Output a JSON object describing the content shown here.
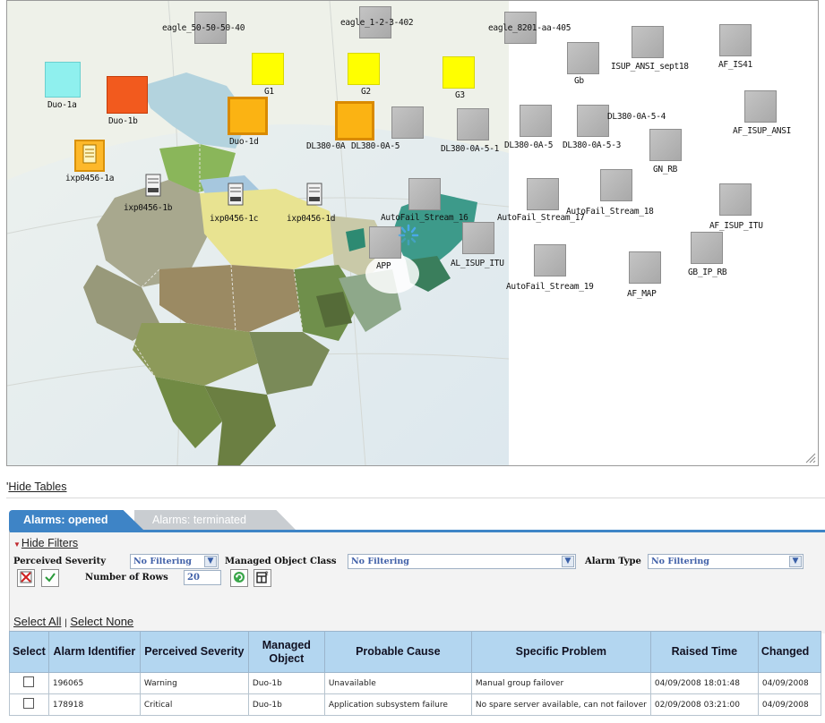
{
  "map": {
    "nodes": [
      {
        "id": "eagle_50-50-50-40",
        "label": "eagle_50-50-50-40",
        "color": "gray"
      },
      {
        "id": "eagle_1-2-3-402",
        "label": "eagle_1-2-3-402",
        "color": "gray"
      },
      {
        "id": "eagle_8201-aa-405",
        "label": "eagle_8201-aa-405",
        "color": "gray"
      },
      {
        "id": "Gb",
        "label": "Gb",
        "color": "gray"
      },
      {
        "id": "ISUP_ANSI_sept18",
        "label": "ISUP_ANSI_sept18",
        "color": "gray"
      },
      {
        "id": "AF_IS41",
        "label": "AF_IS41",
        "color": "gray"
      },
      {
        "id": "G1",
        "label": "G1",
        "color": "yellow"
      },
      {
        "id": "G2",
        "label": "G2",
        "color": "yellow"
      },
      {
        "id": "G3",
        "label": "G3",
        "color": "yellow"
      },
      {
        "id": "Duo-1a",
        "label": "Duo-1a",
        "color": "cyan"
      },
      {
        "id": "Duo-1b",
        "label": "Duo-1b",
        "color": "red"
      },
      {
        "id": "Duo-1d",
        "label": "Duo-1d",
        "color": "orange"
      },
      {
        "id": "DL380-0A",
        "label": "DL380-0A",
        "color": "orange"
      },
      {
        "id": "DL380-0A-5",
        "label": "DL380-0A-5",
        "color": "gray"
      },
      {
        "id": "DL380-0A-5-1",
        "label": "DL380-0A-5-1",
        "color": "gray"
      },
      {
        "id": "DL380-0A-5",
        "label": "DL380-0A-5",
        "color": "gray"
      },
      {
        "id": "DL380-0A-5-3",
        "label": "DL380-0A-5-3",
        "color": "gray"
      },
      {
        "id": "DL380-0A-5-4",
        "label": "DL380-0A-5-4",
        "color": "gray"
      },
      {
        "id": "AF_ISUP_ANSI",
        "label": "AF_ISUP_ANSI",
        "color": "gray"
      },
      {
        "id": "GN_RB",
        "label": "GN_RB",
        "color": "gray"
      },
      {
        "id": "ixp0456-1a",
        "label": "ixp0456-1a",
        "color": "orange"
      },
      {
        "id": "ixp0456-1b",
        "label": "ixp0456-1b",
        "color": "server"
      },
      {
        "id": "ixp0456-1c",
        "label": "ixp0456-1c",
        "color": "server"
      },
      {
        "id": "ixp0456-1d",
        "label": "ixp0456-1d",
        "color": "server"
      },
      {
        "id": "AutoFail_Stream_16",
        "label": "AutoFail_Stream_16",
        "color": "gray"
      },
      {
        "id": "AutoFail_Stream_17",
        "label": "AutoFail_Stream_17",
        "color": "gray"
      },
      {
        "id": "AutoFail_Stream_18",
        "label": "AutoFail_Stream_18",
        "color": "gray"
      },
      {
        "id": "AF_ISUP_ITU",
        "label": "AF_ISUP_ITU",
        "color": "gray"
      },
      {
        "id": "APP",
        "label": "APP",
        "color": "gray"
      },
      {
        "id": "AL_ISUP_ITU",
        "label": "AL_ISUP_ITU",
        "color": "gray"
      },
      {
        "id": "AutoFail_Stream_19",
        "label": "AutoFail_Stream_19",
        "color": "gray"
      },
      {
        "id": "AF_MAP",
        "label": "AF_MAP",
        "color": "gray"
      },
      {
        "id": "GB_IP_RB",
        "label": "GB_IP_RB",
        "color": "gray"
      }
    ]
  },
  "links": {
    "hide_tables": "Hide Tables",
    "hide_filters": "Hide Filters",
    "select_all": "Select All",
    "separator": "|",
    "select_none": "Select None"
  },
  "tabs": [
    {
      "label": "Alarms: opened",
      "active": true
    },
    {
      "label": "Alarms: terminated",
      "active": false
    }
  ],
  "filters": {
    "perceived_severity": {
      "label": "Perceived Severity",
      "value": "No Filtering"
    },
    "managed_object_class": {
      "label": "Managed Object Class",
      "value": "No Filtering"
    },
    "alarm_type": {
      "label": "Alarm Type",
      "value": "No Filtering"
    },
    "number_of_rows": {
      "label": "Number of Rows",
      "value": "20"
    }
  },
  "table": {
    "headers": [
      "Select",
      "Alarm Identifier",
      "Perceived Severity",
      "Managed Object",
      "Probable Cause",
      "Specific Problem",
      "Raised Time",
      "Changed"
    ],
    "rows": [
      {
        "alarm_id": "196065",
        "severity": "Warning",
        "managed_object": "Duo-1b",
        "probable_cause": "Unavailable",
        "specific_problem": "Manual group failover",
        "raised_time": "04/09/2008 18:01:48",
        "changed": "04/09/2008"
      },
      {
        "alarm_id": "178918",
        "severity": "Critical",
        "managed_object": "Duo-1b",
        "probable_cause": "Application subsystem failure",
        "specific_problem": "No spare server available, can not failover",
        "raised_time": "02/09/2008 03:21:00",
        "changed": "04/09/2008"
      }
    ]
  },
  "colors": {
    "tab_active": "#3e84c6",
    "header_bg": "#b3d6f0",
    "severity_warning": "#7fd3ea",
    "severity_critical": "#e0201f"
  }
}
